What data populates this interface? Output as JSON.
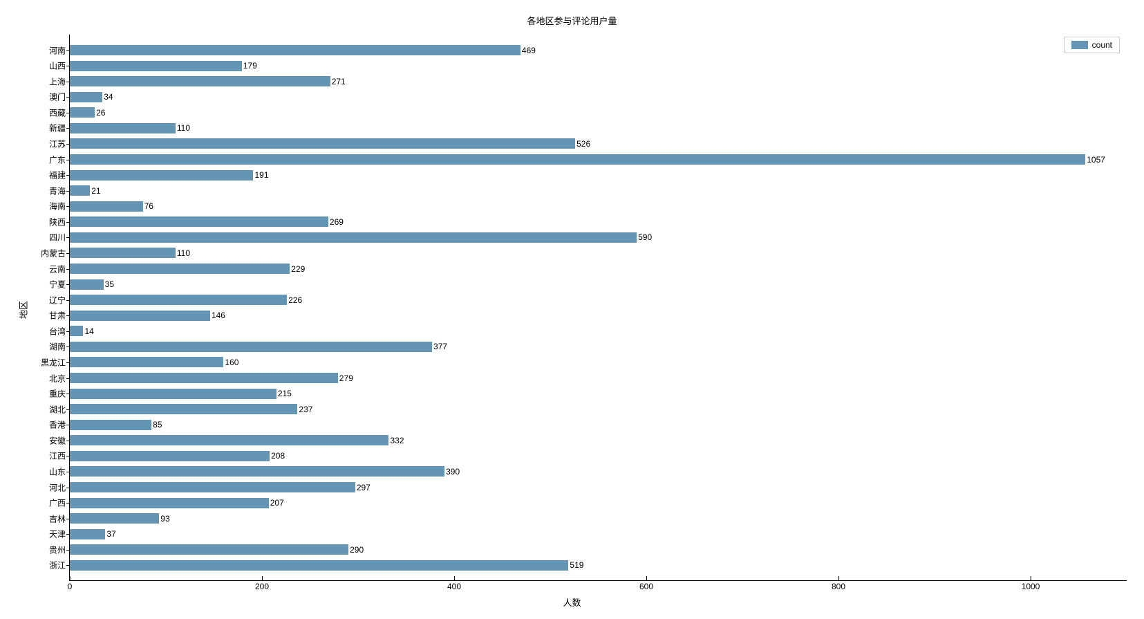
{
  "chart_data": {
    "type": "bar",
    "orientation": "horizontal",
    "title": "各地区参与评论用户量",
    "xlabel": "人数",
    "ylabel": "地区",
    "xlim": [
      0,
      1100
    ],
    "xticks": [
      0,
      200,
      400,
      600,
      800,
      1000
    ],
    "categories": [
      "河南",
      "山西",
      "上海",
      "澳门",
      "西藏",
      "新疆",
      "江苏",
      "广东",
      "福建",
      "青海",
      "海南",
      "陕西",
      "四川",
      "内蒙古",
      "云南",
      "宁夏",
      "辽宁",
      "甘肃",
      "台湾",
      "湖南",
      "黑龙江",
      "北京",
      "重庆",
      "湖北",
      "香港",
      "安徽",
      "江西",
      "山东",
      "河北",
      "广西",
      "吉林",
      "天津",
      "贵州",
      "浙江"
    ],
    "series": [
      {
        "name": "count",
        "values": [
          469,
          179,
          271,
          34,
          26,
          110,
          526,
          1057,
          191,
          21,
          76,
          269,
          590,
          110,
          229,
          35,
          226,
          146,
          14,
          377,
          160,
          279,
          215,
          237,
          85,
          332,
          208,
          390,
          297,
          207,
          93,
          37,
          290,
          519
        ]
      }
    ],
    "legend": {
      "position": "top-right",
      "labels": [
        "count"
      ]
    },
    "bar_color": "#6495b4"
  }
}
